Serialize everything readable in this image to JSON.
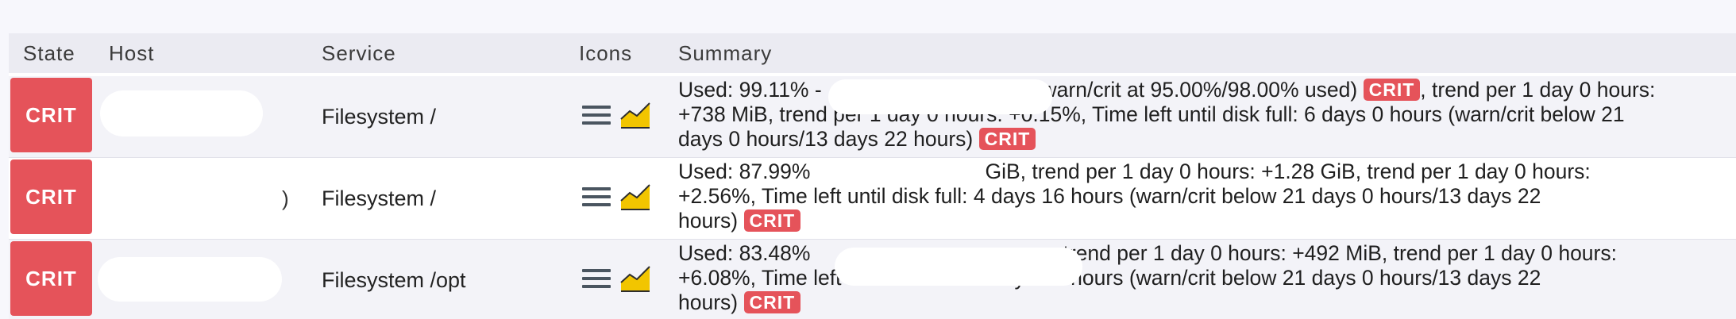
{
  "table": {
    "headers": {
      "state": "State",
      "host": "Host",
      "service": "Service",
      "icons": "Icons",
      "summary": "Summary"
    },
    "rows": [
      {
        "state": "CRIT",
        "service": "Filesystem /",
        "summary_a": "Used: 99.11% -",
        "summary_b": "(warn/crit at 95.00%/98.00% used)",
        "badge1": "CRIT",
        "summary_c": ", trend per 1 day 0 hours:",
        "summary_line2": "+738 MiB, trend per 1 day 0 hours: +0.15%, Time left until disk full: 6 days 0 hours (warn/crit below 21",
        "summary_line3": "days 0 hours/13 days 22 hours)",
        "badge2": "CRIT"
      },
      {
        "state": "CRIT",
        "host_fragment": ")",
        "service": "Filesystem /",
        "summary_a": "Used: 87.99%",
        "summary_b": "GiB, trend per 1 day 0 hours: +1.28 GiB, trend per 1 day 0 hours:",
        "summary_line2": "+2.56%, Time left until disk full: 4 days 16 hours (warn/crit below 21 days 0 hours/13 days 22",
        "summary_line3": "hours)",
        "badge": "CRIT"
      },
      {
        "state": "CRIT",
        "service": "Filesystem /opt",
        "summary_a": "Used: 83.48%",
        "summary_b": "trend per 1 day 0 hours: +492 MiB, trend per 1 day 0 hours:",
        "summary_line2": "+6.08%, Time left until disk full: 2 days 17 hours (warn/crit below 21 days 0 hours/13 days 22",
        "summary_line3": "hours)",
        "badge": "CRIT"
      }
    ]
  },
  "icons": {
    "menu": "menu-icon",
    "perfgraph": "perfgraph-icon"
  },
  "colors": {
    "crit": "#e5535a",
    "header_bg": "#ebebf2",
    "row_alt_bg": "#f3f3f8",
    "graph_yellow": "#f2c500",
    "menu_gray": "#4a5560"
  }
}
